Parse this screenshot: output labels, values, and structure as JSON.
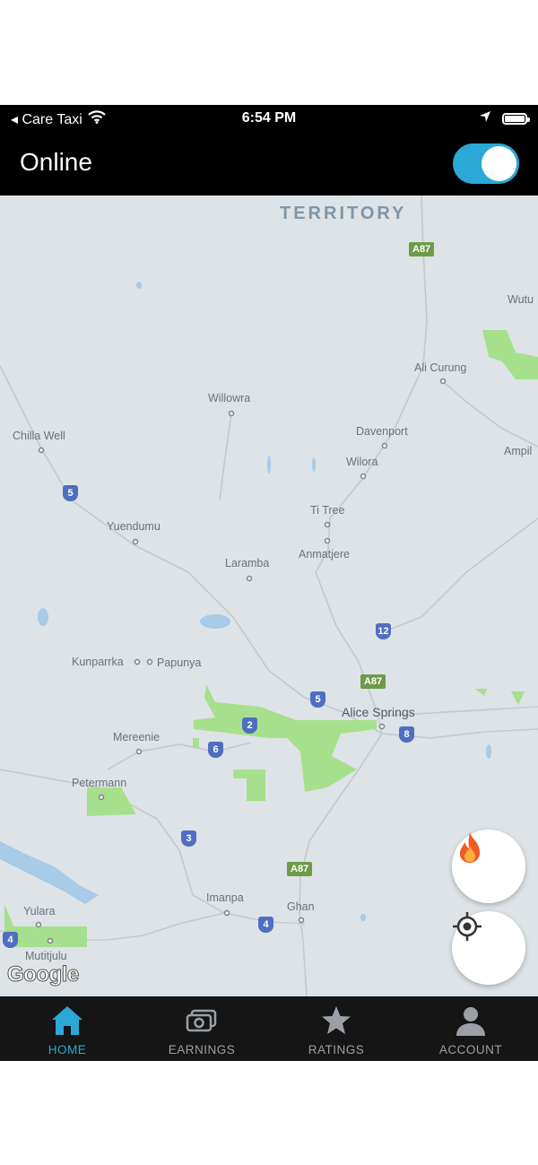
{
  "status_bar": {
    "carrier": "◂ Care Taxi",
    "time": "6:54 PM"
  },
  "header": {
    "title": "Online",
    "toggle_on": true,
    "toggle_color": "#2aa9d6"
  },
  "map": {
    "region_label": "TERRITORY",
    "places": [
      "Wutu",
      "Ali Curung",
      "Willowra",
      "Chilla Well",
      "Davenport",
      "Ampil",
      "Wilora",
      "Ti Tree",
      "Yuendumu",
      "Laramba",
      "Anmatjere",
      "Kunparrka",
      "Papunya",
      "Alice Springs",
      "Mereenie",
      "Petermann",
      "Imanpa",
      "Ghan",
      "Yulara",
      "Mutitjulu"
    ],
    "route_shields": [
      "5",
      "12",
      "5",
      "2",
      "6",
      "8",
      "3",
      "4",
      "4"
    ],
    "highway_tags": [
      "A87",
      "A87",
      "A87"
    ],
    "attribution": "Google"
  },
  "fabs": {
    "hot_zone_icon": "fire-icon",
    "locate_icon": "crosshair-icon"
  },
  "tabs": [
    {
      "label": "HOME",
      "icon": "home-icon",
      "active": true
    },
    {
      "label": "EARNINGS",
      "icon": "money-icon",
      "active": false
    },
    {
      "label": "RATINGS",
      "icon": "star-icon",
      "active": false
    },
    {
      "label": "ACCOUNT",
      "icon": "person-icon",
      "active": false
    }
  ]
}
